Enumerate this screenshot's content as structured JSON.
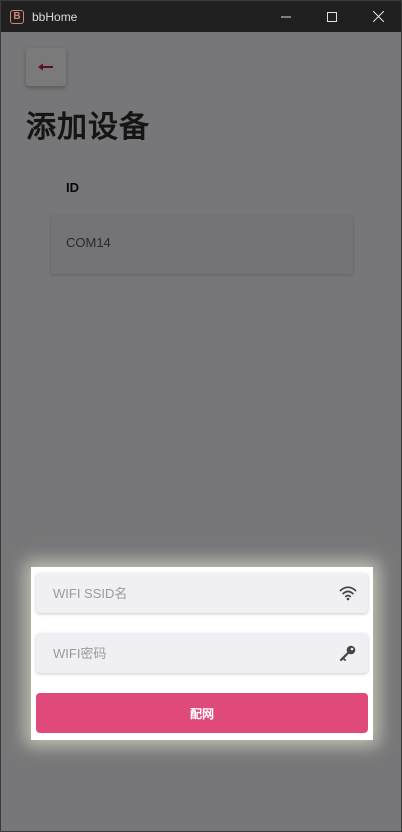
{
  "window": {
    "title": "bbHome",
    "icon_letter": "B"
  },
  "page": {
    "title": "添加设备",
    "back_icon": "arrow-left-icon"
  },
  "device_table": {
    "column_header": "ID",
    "rows": [
      "COM14"
    ]
  },
  "wifi_dialog": {
    "ssid_placeholder": "WIFI SSID名",
    "ssid_value": "",
    "ssid_icon": "wifi-icon",
    "password_placeholder": "WIFI密码",
    "password_value": "",
    "password_icon": "key-icon",
    "submit_label": "配网"
  },
  "colors": {
    "accent": "#e04a7a",
    "back_arrow": "#c2185b",
    "titlebar": "#202020",
    "app_icon": "#c98a74"
  }
}
